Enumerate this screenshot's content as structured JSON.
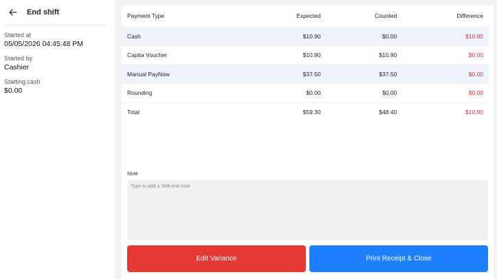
{
  "sidebar": {
    "title": "End shift",
    "fields": [
      {
        "label": "Started at",
        "value": "05/05/2026 04:45:48 PM"
      },
      {
        "label": "Started by",
        "value": "Cashier"
      },
      {
        "label": "Starting cash",
        "value": "$0.00"
      }
    ]
  },
  "table": {
    "headers": [
      "Payment Type",
      "Expected",
      "Counted",
      "Difference"
    ],
    "rows": [
      {
        "type": "Cash",
        "expected": "$10.90",
        "counted": "$0.00",
        "difference": "$10.90"
      },
      {
        "type": "Capita Voucher",
        "expected": "$10.90",
        "counted": "$10.90",
        "difference": "$0.00"
      },
      {
        "type": "Manual PayNow",
        "expected": "$37.50",
        "counted": "$37.50",
        "difference": "$0.00"
      },
      {
        "type": "Rounding",
        "expected": "$0.00",
        "counted": "$0.00",
        "difference": "$0.00"
      },
      {
        "type": "Total",
        "expected": "$59.30",
        "counted": "$48.40",
        "difference": "$10.90"
      }
    ]
  },
  "note": {
    "label": "Note",
    "placeholder": "Type to add a shift end note",
    "value": ""
  },
  "actions": {
    "edit_label": "Edit Variance",
    "print_label": "Print Receipt & Close"
  },
  "colors": {
    "difference": "#d32f2f",
    "edit_button": "#e53935",
    "print_button": "#1e7fff",
    "alt_row": "#eef3fc"
  },
  "icons": {
    "back": "arrow-left-icon"
  }
}
